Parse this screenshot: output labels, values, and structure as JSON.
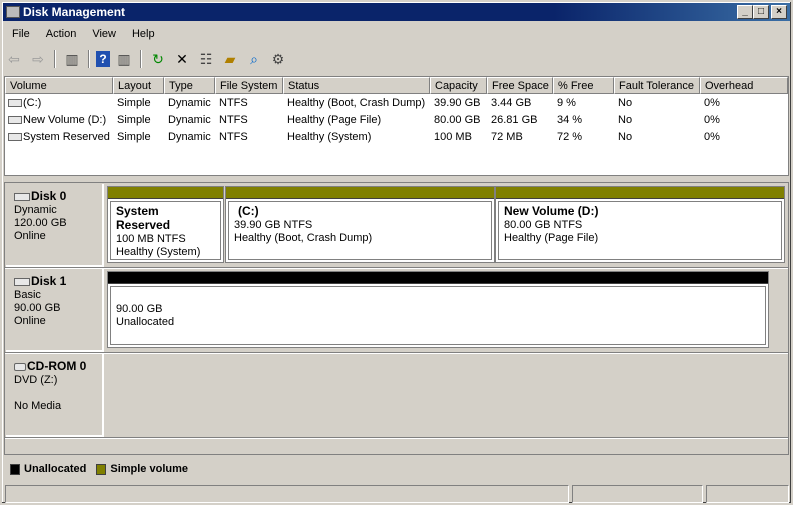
{
  "window": {
    "title": "Disk Management",
    "minimize": "_",
    "maximize": "□",
    "close": "×"
  },
  "menu": [
    "File",
    "Action",
    "View",
    "Help"
  ],
  "toolbar": [
    "back-icon",
    "forward-icon",
    "console-tree-icon",
    "help-icon",
    "action-pane-icon",
    "refresh-icon",
    "delete-icon",
    "properties-icon",
    "open-icon",
    "find-icon",
    "settings-icon"
  ],
  "volume_list": {
    "columns": [
      "Volume",
      "Layout",
      "Type",
      "File System",
      "Status",
      "Capacity",
      "Free Space",
      "% Free",
      "Fault Tolerance",
      "Overhead"
    ],
    "rows": [
      [
        "(C:)",
        "Simple",
        "Dynamic",
        "NTFS",
        "Healthy (Boot, Crash Dump)",
        "39.90 GB",
        "3.44 GB",
        "9 %",
        "No",
        "0%"
      ],
      [
        "New Volume (D:)",
        "Simple",
        "Dynamic",
        "NTFS",
        "Healthy (Page File)",
        "80.00 GB",
        "26.81 GB",
        "34 %",
        "No",
        "0%"
      ],
      [
        "System Reserved",
        "Simple",
        "Dynamic",
        "NTFS",
        "Healthy (System)",
        "100 MB",
        "72 MB",
        "72 %",
        "No",
        "0%"
      ]
    ]
  },
  "disks": [
    {
      "name": "Disk 0",
      "type": "Dynamic",
      "size": "120.00 GB",
      "status": "Online",
      "partitions": [
        {
          "name": "System Reserved",
          "size": "100 MB NTFS",
          "status": "Healthy (System)"
        },
        {
          "name": "(C:)",
          "size": "39.90 GB NTFS",
          "status": "Healthy (Boot, Crash Dump)"
        },
        {
          "name": "New Volume  (D:)",
          "size": "80.00 GB NTFS",
          "status": "Healthy (Page File)"
        }
      ]
    },
    {
      "name": "Disk 1",
      "type": "Basic",
      "size": "90.00 GB",
      "status": "Online",
      "partitions": [
        {
          "size": "90.00 GB",
          "status": "Unallocated"
        }
      ]
    },
    {
      "name": "CD-ROM 0",
      "type": "DVD (Z:)",
      "status": "No Media"
    }
  ],
  "legend": [
    {
      "label": "Unallocated",
      "color": "#000000"
    },
    {
      "label": "Simple volume",
      "color": "#808000"
    }
  ]
}
